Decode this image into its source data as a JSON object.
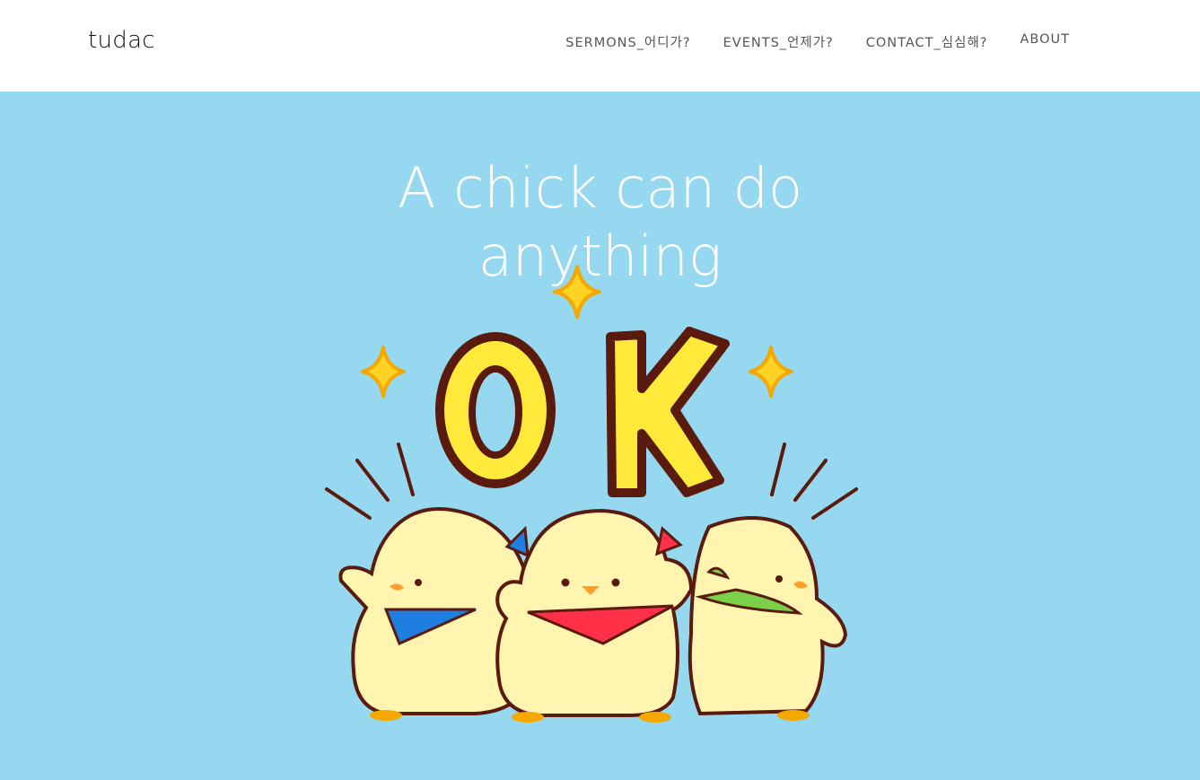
{
  "header": {
    "logo": "tudac",
    "nav": [
      {
        "label": "SERMONS_어디가?"
      },
      {
        "label": "EVENTS_언제가?"
      },
      {
        "label": "CONTACT_심심해?"
      },
      {
        "label": "ABOUT"
      }
    ]
  },
  "hero": {
    "title_line1": "A chick can do",
    "title_line2": "anything",
    "background_color": "#95d8ef",
    "illustration": {
      "name": "ok-chicks-illustration",
      "text": "OK"
    }
  }
}
